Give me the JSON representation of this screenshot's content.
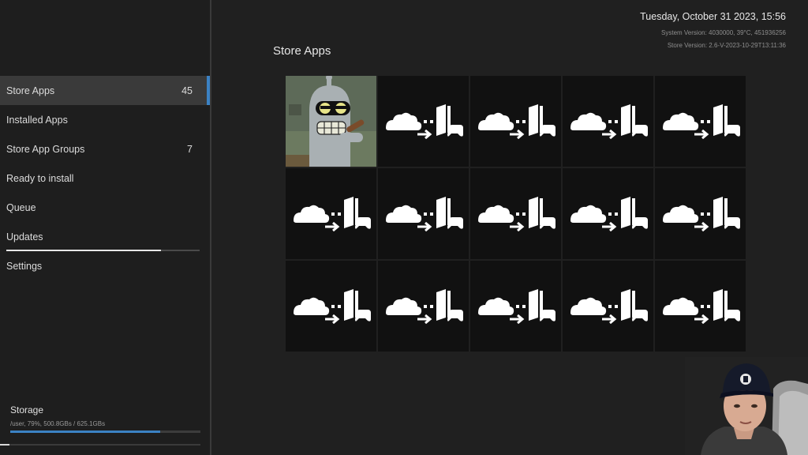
{
  "header": {
    "datetime": "Tuesday, October 31 2023, 15:56",
    "system_version": "System Version: 4030000, 39°C, 451936256",
    "store_version": "Store Version: 2.6-V-2023-10-29T13:11:36"
  },
  "main": {
    "title": "Store Apps"
  },
  "sidebar": {
    "items": [
      {
        "label": "Store Apps",
        "count": "45",
        "active": true
      },
      {
        "label": "Installed Apps",
        "count": ""
      },
      {
        "label": "Store App Groups",
        "count": "7"
      },
      {
        "label": "Ready to install",
        "count": ""
      },
      {
        "label": "Queue",
        "count": ""
      },
      {
        "label": "Updates",
        "count": ""
      },
      {
        "label": "Settings",
        "count": ""
      }
    ],
    "updates_progress_percent": 80
  },
  "storage": {
    "title": "Storage",
    "detail": "/user, 79%, 500.8GBs / 625.1GBs",
    "used_percent": 79
  },
  "grid": {
    "columns": 5,
    "rows": 3,
    "featured_tile_index": 0,
    "placeholder_icon": "cloud-download-to-console-icon"
  },
  "colors": {
    "accent": "#3b82c4",
    "background": "#202020",
    "sidebar_active": "#3a3a3a",
    "tile": "#111111"
  }
}
